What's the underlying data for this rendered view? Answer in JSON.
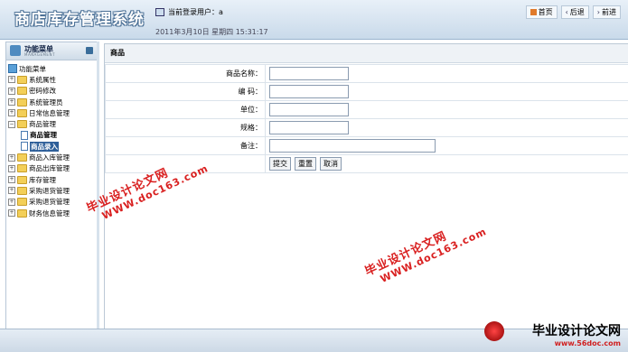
{
  "header": {
    "app_title": "商店库存管理系统",
    "current_user_label": "当前登录用户：a",
    "datetime": "2011年3月10日  星期四  15:31:17",
    "nav": [
      {
        "label": "首页",
        "icon": "home-icon"
      },
      {
        "label": "后退",
        "icon": "back-icon"
      },
      {
        "label": "前进",
        "icon": "forward-icon"
      }
    ]
  },
  "sidebar": {
    "title": "功能菜单",
    "subtitle": "MANAGEMENT",
    "tree": [
      {
        "label": "功能菜单",
        "type": "root"
      },
      {
        "label": "系统属性",
        "type": "folder"
      },
      {
        "label": "密码修改",
        "type": "folder"
      },
      {
        "label": "系统管理员",
        "type": "folder"
      },
      {
        "label": "日常信息管理",
        "type": "folder"
      },
      {
        "label": "商品管理",
        "type": "folder-open"
      },
      {
        "label": "商品管理",
        "type": "doc"
      },
      {
        "label": "商品录入",
        "type": "doc-selected"
      },
      {
        "label": "商品入库管理",
        "type": "folder"
      },
      {
        "label": "商品出库管理",
        "type": "folder"
      },
      {
        "label": "库存管理",
        "type": "folder"
      },
      {
        "label": "采购退货管理",
        "type": "folder"
      },
      {
        "label": "采购退货管理",
        "type": "folder"
      },
      {
        "label": "财务信息管理",
        "type": "folder"
      }
    ]
  },
  "main": {
    "section_title": "商品",
    "fields": [
      {
        "label": "商品名称：",
        "value": ""
      },
      {
        "label": "编  码：",
        "value": ""
      },
      {
        "label": "单位：",
        "value": ""
      },
      {
        "label": "规格：",
        "value": ""
      },
      {
        "label": "备注：",
        "value": ""
      }
    ],
    "buttons": {
      "submit": "提交",
      "reset": "重置",
      "cancel": "取消"
    }
  },
  "watermarks": {
    "cn": "毕业设计论文网",
    "en": "WWW.doc163.com"
  },
  "corner_logo": {
    "cn": "毕业设计论文网",
    "en": "www.56doc.com"
  },
  "colors": {
    "watermark": "#d91f1f",
    "selected_bg": "#2e5f99",
    "header_bg": "#c9daea"
  }
}
